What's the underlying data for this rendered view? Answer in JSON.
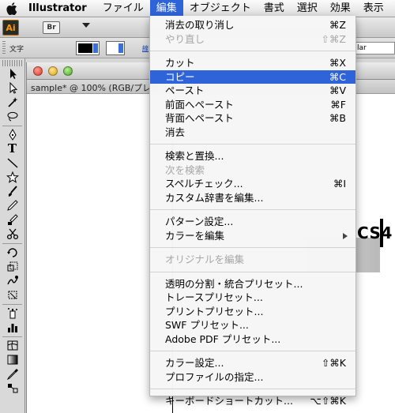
{
  "menubar": {
    "app_name": "Illustrator",
    "items": [
      "ファイル",
      "編集",
      "オブジェクト",
      "書式",
      "選択",
      "効果",
      "表示"
    ],
    "active_index": 1
  },
  "appbar": {
    "logo": "Ai",
    "bridge_icon": "Br"
  },
  "control": {
    "label": "文字",
    "link_text": "線",
    "style_value": "lar"
  },
  "document": {
    "tab_title": "sample* @ 100% (RGB/プレビュー)",
    "art_text": "CS4"
  },
  "edit_menu": {
    "groups": [
      [
        {
          "label": "消去の取り消し",
          "shortcut": "⌘Z",
          "disabled": false
        },
        {
          "label": "やり直し",
          "shortcut": "⇧⌘Z",
          "disabled": true
        }
      ],
      [
        {
          "label": "カット",
          "shortcut": "⌘X",
          "disabled": false
        },
        {
          "label": "コピー",
          "shortcut": "⌘C",
          "disabled": false,
          "highlighted": true
        },
        {
          "label": "ペースト",
          "shortcut": "⌘V",
          "disabled": false
        },
        {
          "label": "前面へペースト",
          "shortcut": "⌘F",
          "disabled": false
        },
        {
          "label": "背面へペースト",
          "shortcut": "⌘B",
          "disabled": false
        },
        {
          "label": "消去",
          "shortcut": "",
          "disabled": false
        }
      ],
      [
        {
          "label": "検索と置換...",
          "shortcut": "",
          "disabled": false
        },
        {
          "label": "次を検索",
          "shortcut": "",
          "disabled": true
        },
        {
          "label": "スペルチェック...",
          "shortcut": "⌘I",
          "disabled": false
        },
        {
          "label": "カスタム辞書を編集...",
          "shortcut": "",
          "disabled": false
        }
      ],
      [
        {
          "label": "パターン設定...",
          "shortcut": "",
          "disabled": false
        },
        {
          "label": "カラーを編集",
          "shortcut": "",
          "disabled": false,
          "submenu": true
        }
      ],
      [
        {
          "label": "オリジナルを編集",
          "shortcut": "",
          "disabled": true
        }
      ],
      [
        {
          "label": "透明の分割・統合プリセット...",
          "shortcut": "",
          "disabled": false
        },
        {
          "label": "トレースプリセット...",
          "shortcut": "",
          "disabled": false
        },
        {
          "label": "プリントプリセット...",
          "shortcut": "",
          "disabled": false
        },
        {
          "label": "SWF プリセット...",
          "shortcut": "",
          "disabled": false
        },
        {
          "label": "Adobe PDF プリセット...",
          "shortcut": "",
          "disabled": false
        }
      ],
      [
        {
          "label": "カラー設定...",
          "shortcut": "⇧⌘K",
          "disabled": false
        },
        {
          "label": "プロファイルの指定...",
          "shortcut": "",
          "disabled": false
        }
      ],
      [
        {
          "label": "キーボードショートカット...",
          "shortcut": "⌥⇧⌘K",
          "disabled": false
        }
      ]
    ]
  },
  "colors": {
    "highlight": "#2f63d8",
    "disabled_text": "#a6a6a6",
    "menubar_active": "#2f63d8"
  },
  "tools": [
    "selection-tool-icon",
    "direct-selection-tool-icon",
    "magic-wand-icon",
    "lasso-icon",
    "pen-icon",
    "type-icon",
    "line-segment-icon",
    "star-icon",
    "paintbrush-icon",
    "pencil-icon",
    "blob-brush-icon",
    "scissors-icon",
    "rotate-icon",
    "scale-icon",
    "warp-icon",
    "free-transform-icon",
    "symbol-sprayer-icon",
    "column-graph-icon",
    "mesh-icon",
    "gradient-icon",
    "eyedropper-icon",
    "blend-icon"
  ]
}
